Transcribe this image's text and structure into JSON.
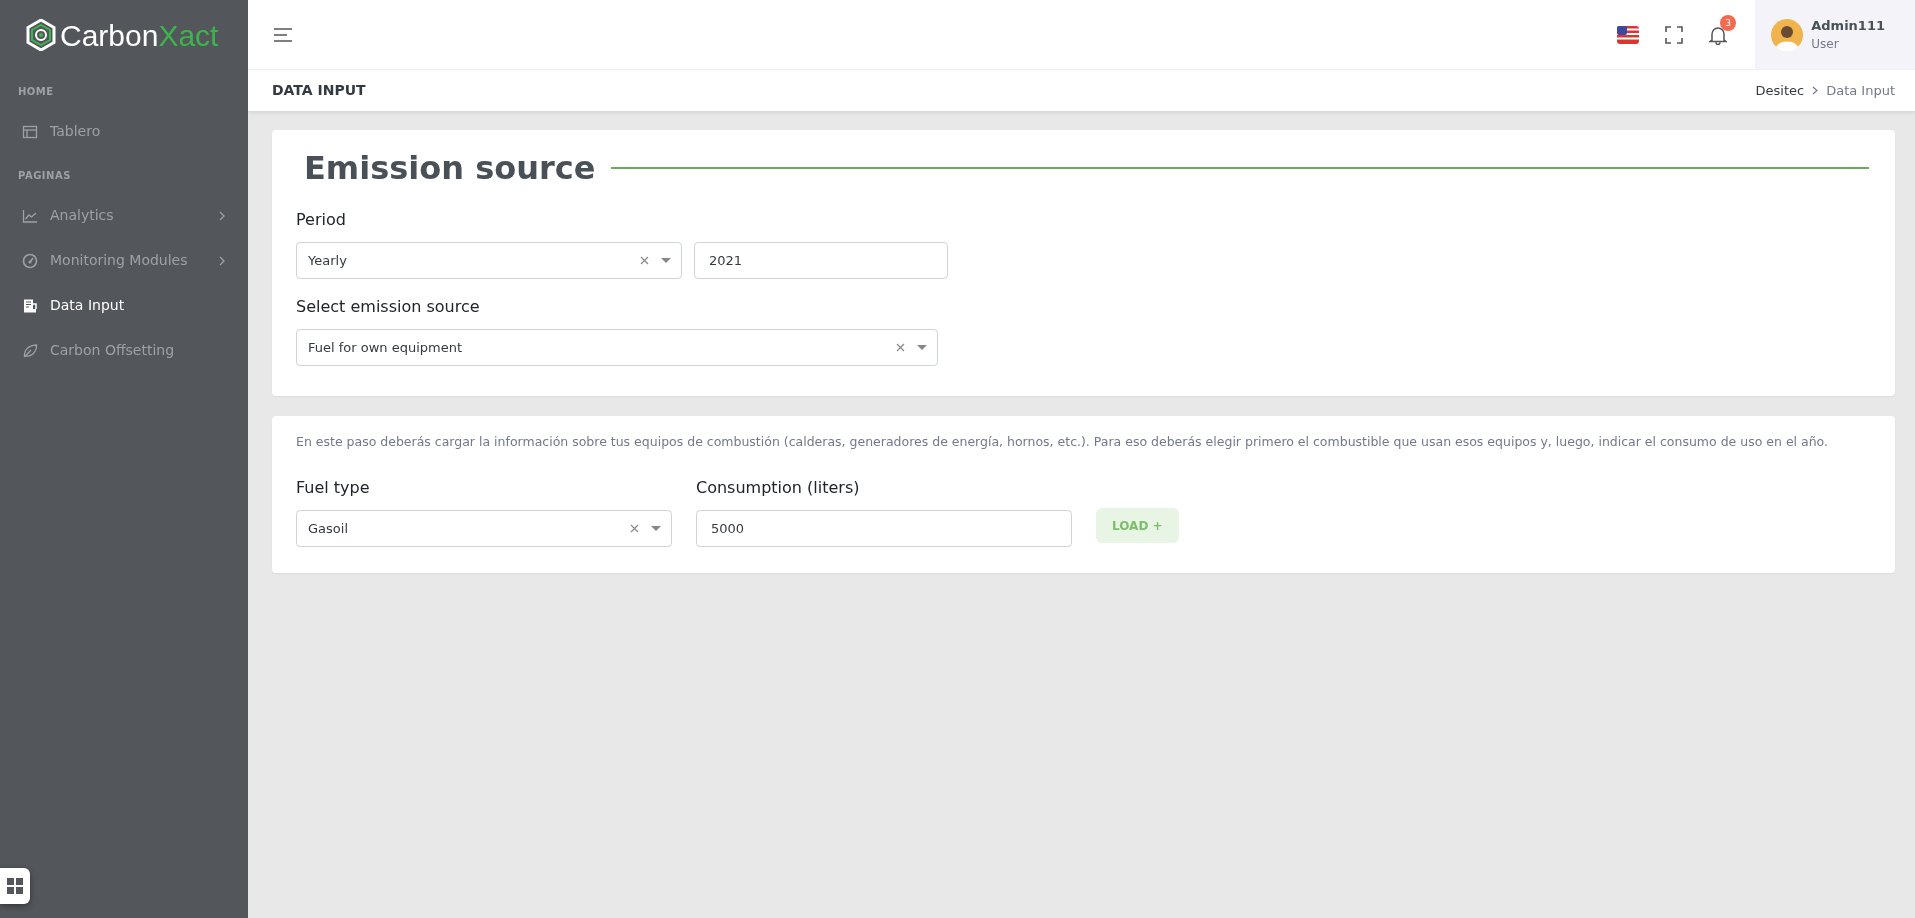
{
  "sidebar": {
    "logo": {
      "part1": "Carbon",
      "part2": "Xact"
    },
    "sections": [
      {
        "heading": "HOME",
        "items": [
          {
            "label": "Tablero",
            "selected": false,
            "expandable": false
          }
        ]
      },
      {
        "heading": "PAGINAS",
        "items": [
          {
            "label": "Analytics",
            "selected": false,
            "expandable": true
          },
          {
            "label": "Monitoring Modules",
            "selected": false,
            "expandable": true
          },
          {
            "label": "Data Input",
            "selected": true,
            "expandable": false
          },
          {
            "label": "Carbon Offsetting",
            "selected": false,
            "expandable": false
          }
        ]
      }
    ]
  },
  "topbar": {
    "notification_count": "3",
    "user": {
      "name": "Admin111",
      "role": "User"
    }
  },
  "page_header": {
    "title": "DATA INPUT",
    "breadcrumb": [
      "Desitec",
      "Data Input"
    ]
  },
  "emission_card": {
    "title": "Emission source",
    "period_label": "Period",
    "period_select": "Yearly",
    "year": "2021",
    "source_label": "Select emission source",
    "source_select": "Fuel for own equipment"
  },
  "fuel_card": {
    "description": "En este paso deberás cargar la información sobre tus equipos de combustión (calderas, generadores de energía, hornos, etc.). Para eso deberás elegir primero el combustible que usan esos equipos y, luego, indicar el consumo de uso en el año.",
    "fuel_label": "Fuel type",
    "fuel_select": "Gasoil",
    "consumption_label": "Consumption (liters)",
    "consumption": "5000",
    "load_button": "LOAD +"
  }
}
